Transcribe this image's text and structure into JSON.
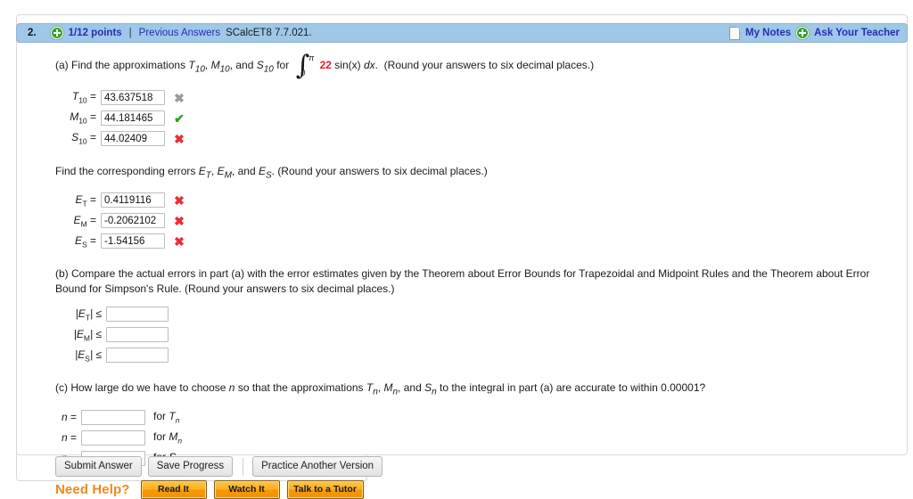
{
  "header": {
    "question_number": "2.",
    "points": "1/12 points",
    "separator": "|",
    "previous_answers": "Previous Answers",
    "textbook_ref": "SCalcET8 7.7.021.",
    "my_notes": "My Notes",
    "ask_your_teacher": "Ask Your Teacher",
    "plus_icon": "plus-circle-icon",
    "notes_icon": "notes-page-icon",
    "bar_color": "#9ec7e8",
    "link_color": "#2b2bb5"
  },
  "part_a": {
    "text_before": "(a) Find the approximations",
    "sym1": "T",
    "sub1": "10",
    "sym2": "M",
    "sub2": "10",
    "sym3": "S",
    "sub3": "10",
    "text_for": "for",
    "integral": {
      "upper_limit": "π",
      "lower_limit": "0",
      "coefficient": "22",
      "coefficient_color": "#e8192c",
      "integrand": "sin(x)",
      "differential": "dx"
    },
    "text_after": "(Round your answers to six decimal places.)",
    "rows": [
      {
        "label_sym": "T",
        "label_sub": "10",
        "value": "43.637518",
        "mark": "x-gray"
      },
      {
        "label_sym": "M",
        "label_sub": "10",
        "value": "44.181465",
        "mark": "check"
      },
      {
        "label_sym": "S",
        "label_sub": "10",
        "value": "44.02409",
        "mark": "x-red"
      }
    ]
  },
  "errors": {
    "prompt_before": "Find the corresponding errors",
    "sym1": "E",
    "sub1": "T",
    "sym2": "E",
    "sub2": "M",
    "sym3": "E",
    "sub3": "S",
    "prompt_after": "(Round your answers to six decimal places.)",
    "rows": [
      {
        "label_sym": "E",
        "label_sub": "T",
        "value": "0.4119116",
        "mark": "x-red"
      },
      {
        "label_sym": "E",
        "label_sub": "M",
        "value": "-0.2062102",
        "mark": "x-red"
      },
      {
        "label_sym": "E",
        "label_sub": "S",
        "value": "-1.54156",
        "mark": "x-red"
      }
    ]
  },
  "part_b": {
    "text": "(b) Compare the actual errors in part (a) with the error estimates given by the Theorem about Error Bounds for Trapezoidal and Midpoint Rules and the Theorem about Error Bound for Simpson's Rule. (Round your answers to six decimal places.)",
    "rows": [
      {
        "label_sym": "E",
        "label_sub": "T",
        "relation": "≤",
        "value": "",
        "placeholder": ""
      },
      {
        "label_sym": "E",
        "label_sub": "M",
        "relation": "≤",
        "value": "",
        "placeholder": ""
      },
      {
        "label_sym": "E",
        "label_sub": "S",
        "relation": "≤",
        "value": "",
        "placeholder": ""
      }
    ]
  },
  "part_c": {
    "text_before": "(c) How large do we have to choose",
    "var_n": "n",
    "text_mid": "so that the approximations",
    "sym1": "T",
    "sub1": "n",
    "sym2": "M",
    "sub2": "n",
    "sym3": "S",
    "sub3": "n",
    "text_after": "to the integral in part (a) are accurate to within 0.00001?",
    "rows": [
      {
        "label": "n",
        "eq": "=",
        "value": "",
        "for_text": "for",
        "for_sym": "T",
        "for_sub": "n"
      },
      {
        "label": "n",
        "eq": "=",
        "value": "",
        "for_text": "for",
        "for_sym": "M",
        "for_sub": "n"
      },
      {
        "label": "n",
        "eq": "=",
        "value": "",
        "for_text": "for",
        "for_sym": "S",
        "for_sub": "n"
      }
    ]
  },
  "need_help": {
    "label": "Need Help?",
    "label_color": "#f08a1e",
    "buttons": [
      {
        "label": "Read It"
      },
      {
        "label": "Watch It"
      },
      {
        "label": "Talk to a Tutor"
      }
    ]
  },
  "footer": {
    "submit": "Submit Answer",
    "save": "Save Progress",
    "practice": "Practice Another Version"
  }
}
